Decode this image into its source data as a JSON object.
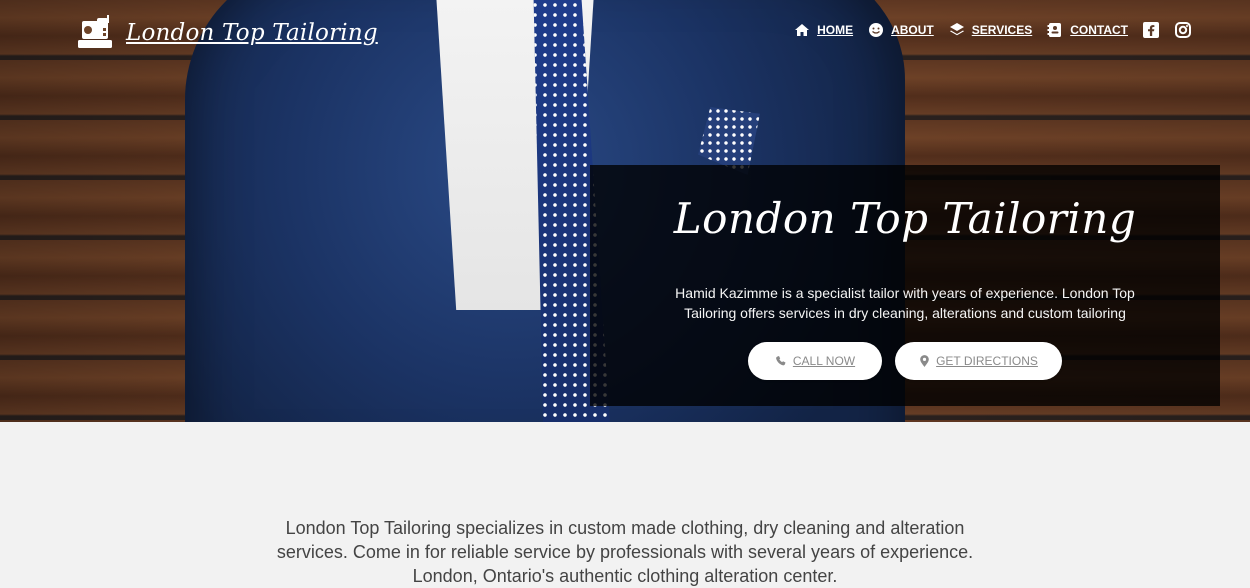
{
  "brand": {
    "title": "London Top Tailoring"
  },
  "nav": {
    "items": [
      {
        "label": "HOME",
        "icon": "home-icon"
      },
      {
        "label": "ABOUT",
        "icon": "smile-icon"
      },
      {
        "label": "SERVICES",
        "icon": "layers-icon"
      },
      {
        "label": "CONTACT",
        "icon": "contact-card-icon"
      }
    ],
    "social": [
      {
        "icon": "facebook-icon"
      },
      {
        "icon": "instagram-icon"
      }
    ]
  },
  "hero": {
    "title": "London Top Tailoring",
    "description": "Hamid Kazimme is a specialist tailor with years of experience. London Top Tailoring offers services in dry cleaning, alterations and custom tailoring",
    "buttons": {
      "call": "CALL NOW",
      "directions": "GET DIRECTIONS"
    }
  },
  "main": {
    "intro": "London Top Tailoring specializes in custom made clothing, dry cleaning and alteration services. Come in for reliable service by professionals with several years of experience. London, Ontario's authentic clothing alteration center."
  },
  "colors": {
    "overlay": "#000000",
    "button_text": "#8a8a8a",
    "body_bg": "#f2f2f2",
    "text": "#444444",
    "white": "#ffffff"
  }
}
